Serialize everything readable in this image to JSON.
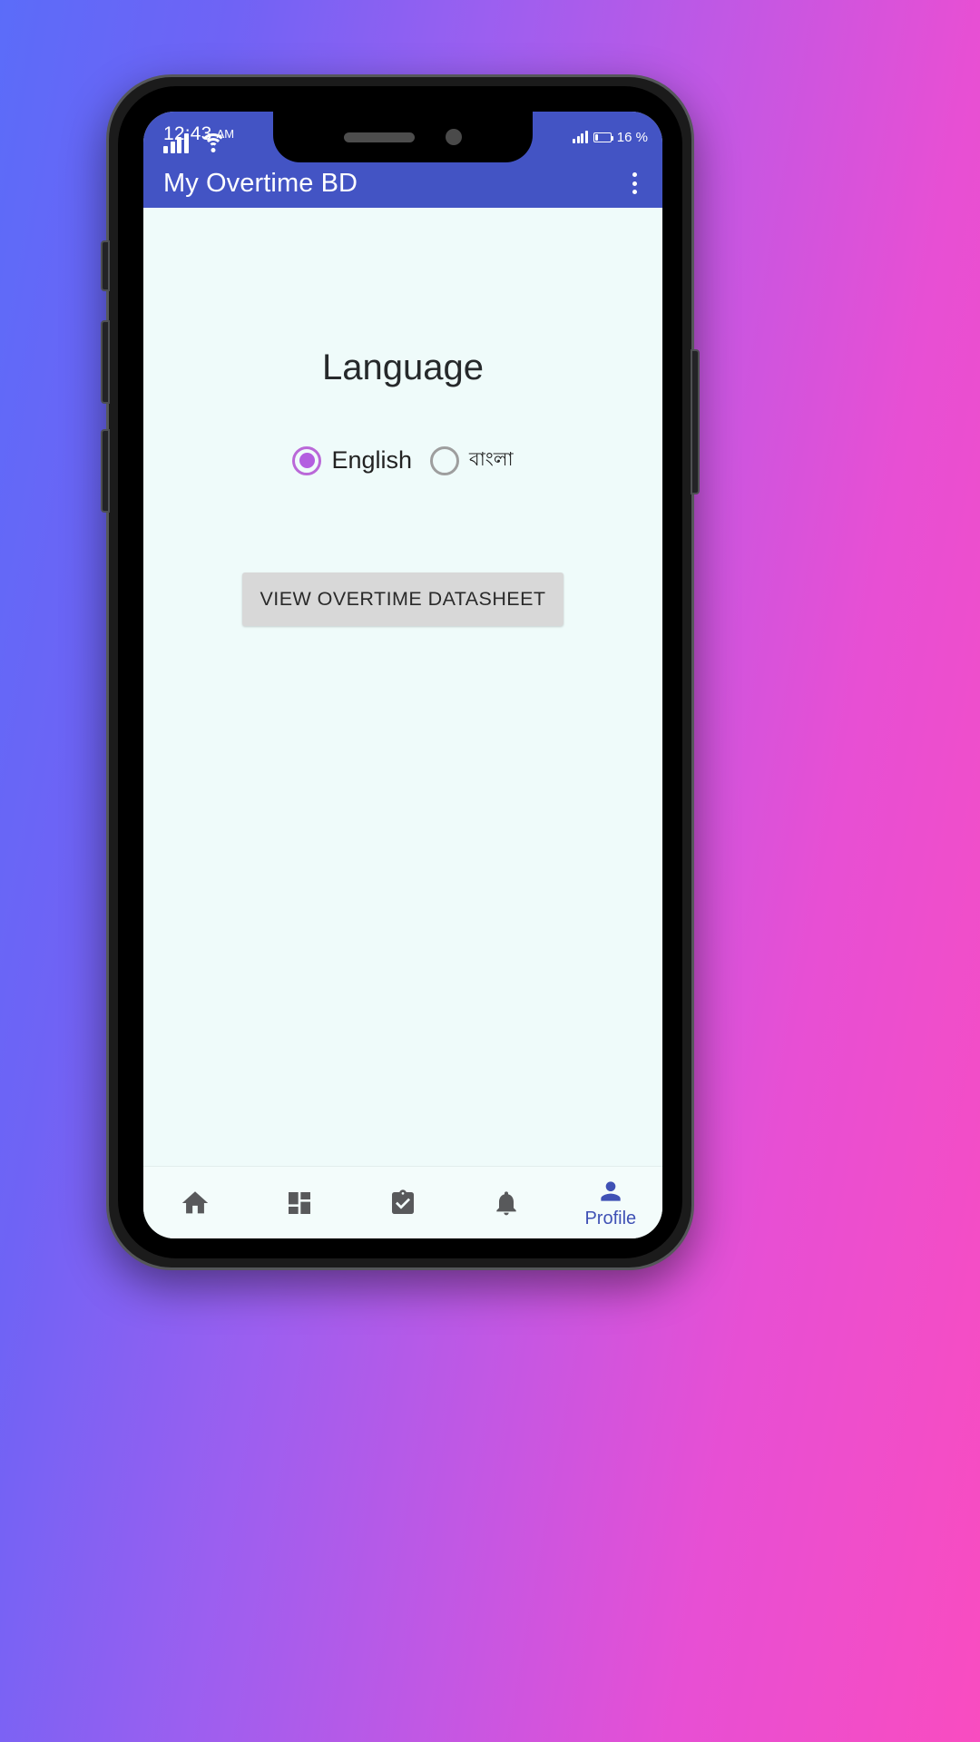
{
  "statusbar": {
    "time": "12:43",
    "ampm": "AM",
    "signal_icon": "signal-bars-icon",
    "wifi_icon": "wifi-icon",
    "signal2_icon": "signal-bars-small-icon",
    "battery_icon": "battery-icon",
    "battery_text": "16 %"
  },
  "appbar": {
    "title": "My Overtime BD",
    "overflow_icon": "overflow-menu-icon",
    "background": "#4354c4"
  },
  "main": {
    "heading": "Language",
    "accent": "#b35ee0",
    "language_options": [
      {
        "label": "English",
        "selected": true
      },
      {
        "label": "বাংলা",
        "selected": false
      }
    ],
    "datasheet_button": "VIEW OVERTIME DATASHEET"
  },
  "bottomnav": {
    "active_color": "#3f51b5",
    "inactive_color": "#58595b",
    "items": [
      {
        "icon": "home-icon",
        "label": "",
        "active": false
      },
      {
        "icon": "dashboard-icon",
        "label": "",
        "active": false
      },
      {
        "icon": "task-checklist-icon",
        "label": "",
        "active": false
      },
      {
        "icon": "bell-notification-icon",
        "label": "",
        "active": false
      },
      {
        "icon": "profile-person-icon",
        "label": "Profile",
        "active": true
      }
    ]
  }
}
